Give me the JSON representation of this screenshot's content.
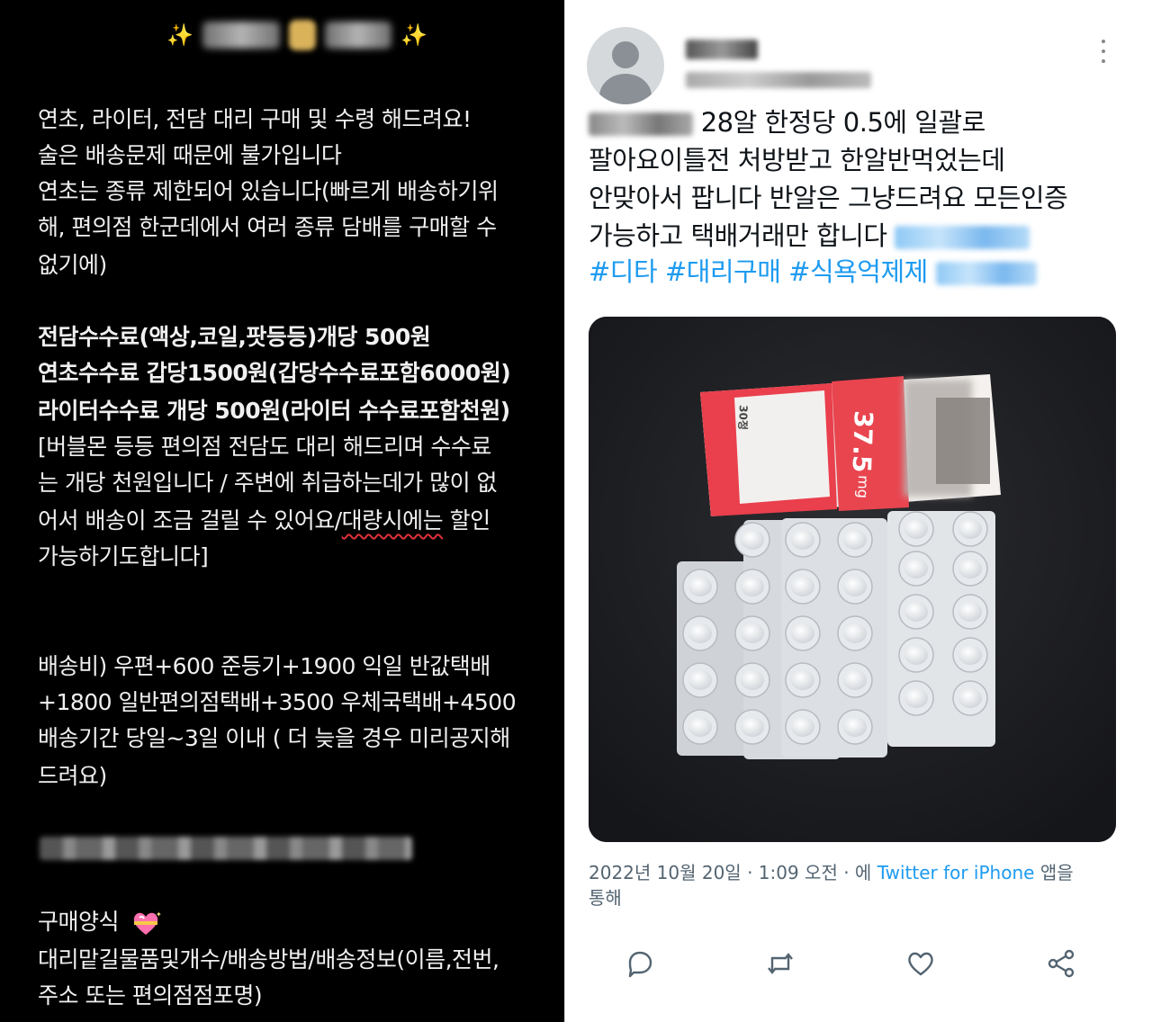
{
  "left_post": {
    "title_blurred": "✨ 행행쓰 🙏 댈샵 ✨",
    "intro": [
      "연초, 라이터, 전담 대리 구매 및 수령 해드려요!",
      "술은 배송문제 때문에 불가입니다",
      "연초는 종류 제한되어 있습니다(빠르게 배송하기위",
      "해, 편의점 한군데에서 여러 종류 담배를 구매할 수",
      "없기에)"
    ],
    "fees": [
      "전담수수료(액상,코일,팟등등)개당 500원",
      "연초수수료 갑당1500원(갑당수수료포함6000원)",
      "라이터수수료 개당 500원(라이터 수수료포함천원)"
    ],
    "notice": [
      "[버블몬 등등 편의점 전담도 대리 해드리며 수수료",
      "는 개당 천원입니다 / 주변에 취급하는데가 많이 없",
      "어서 배송이 조금 걸릴 수 있어요/",
      "대량시에는",
      " 할인",
      "가능하기도합니다]"
    ],
    "shipping": [
      "배송비) 우편+600 준등기+1900 익일 반값택배",
      "+1800 일반편의점택배+3500 우체국택배+4500",
      "배송기간 당일~3일 이내 ( 더 늦을 경우 미리공지해",
      "드려요)"
    ],
    "order_form_label": "구매양식",
    "order_form": [
      "대리맡길물품및개수/배송방법/배송정보(이름,전번,",
      "주소 또는 편의점점포명)"
    ]
  },
  "tweet": {
    "lines": [
      "28알 한정당 0.5에 일괄로",
      "팔아요이틀전 처방받고 한알반먹었는데",
      "안맞아서 팝니다 반알은 그냥드려요 모든인증",
      "가능하고 택배거래만 합니다"
    ],
    "hashtags": [
      "#디타",
      "#대리구매",
      "#식욕억제제"
    ],
    "image": {
      "box_dose": "37.5",
      "box_unit": "mg",
      "box_count": "30정"
    },
    "timestamp": "2022년 10월 20일 · 1:09 오전 · 에",
    "source_app": "Twitter for iPhone",
    "via_suffix": "앱을",
    "via_line2": "통해",
    "icons": [
      "reply-icon",
      "retweet-icon",
      "like-icon",
      "share-icon",
      "more-icon"
    ]
  },
  "colors": {
    "link": "#1d9bf0",
    "left_bg": "#000000",
    "right_bg": "#ffffff"
  }
}
